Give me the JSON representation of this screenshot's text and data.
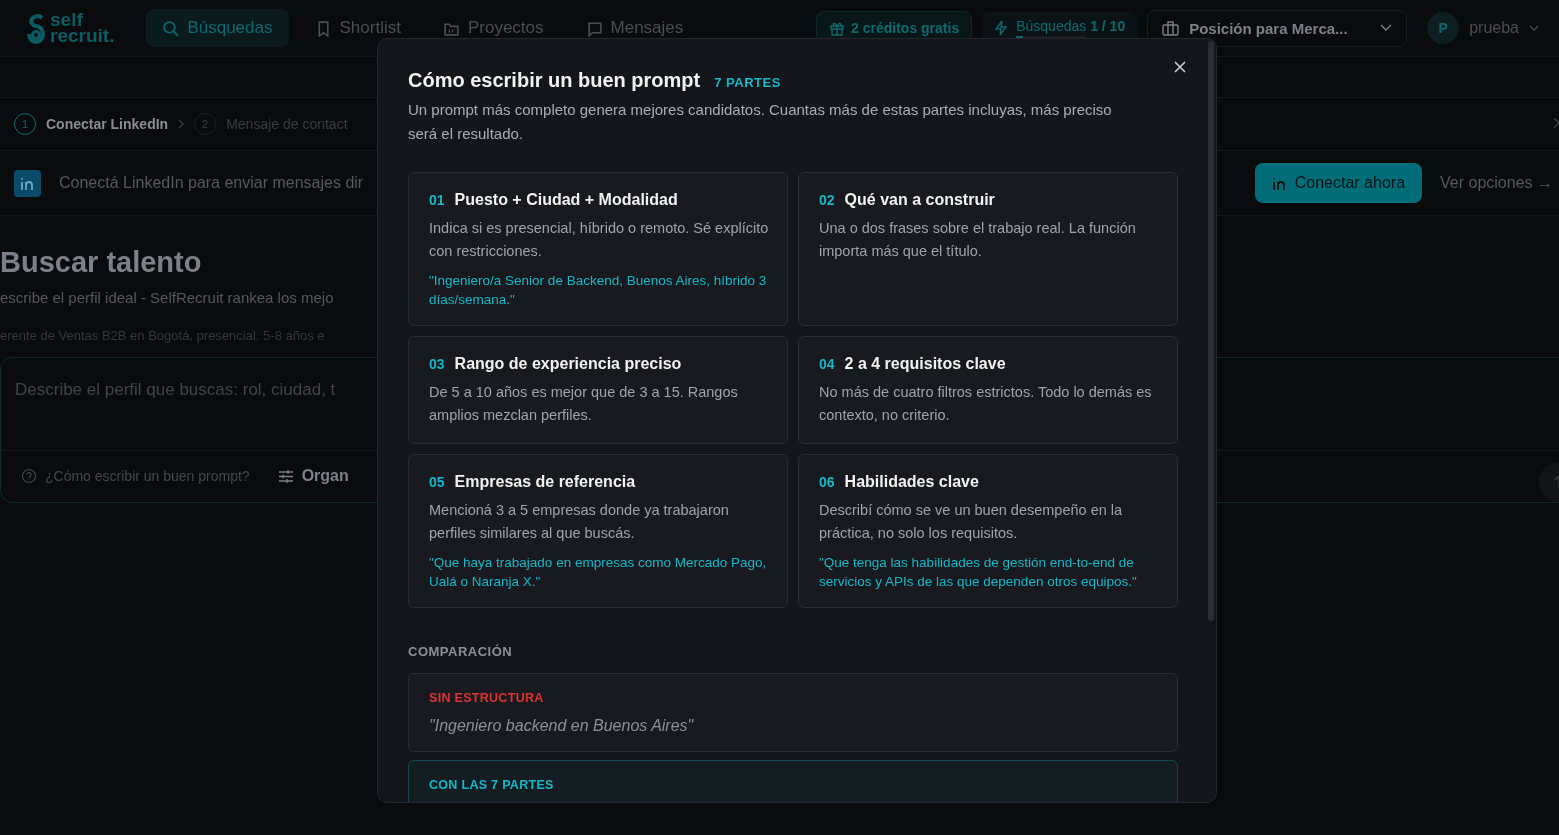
{
  "header": {
    "logo": [
      "self",
      "recruit."
    ],
    "nav": [
      {
        "label": "Búsquedas",
        "selected": true
      },
      {
        "label": "Shortlist",
        "selected": false
      },
      {
        "label": "Proyectos",
        "selected": false
      },
      {
        "label": "Mensajes",
        "selected": false
      }
    ],
    "credits": "2 créditos gratis",
    "searches": {
      "label": "Búsquedas",
      "count": "1 / 10",
      "level": 0.1
    },
    "position": "Posición para Merca...",
    "user": {
      "initial": "P",
      "name": "prueba"
    }
  },
  "steps": [
    {
      "number": "1",
      "label": "Conectar LinkedIn",
      "selected": true
    },
    {
      "number": "2",
      "label": "Mensaje de contact",
      "selected": false
    }
  ],
  "banner": {
    "text": "Conectá LinkedIn para enviar mensajes dir",
    "button": "Conectar ahora",
    "link": "Ver opciones →"
  },
  "main": {
    "title": "Buscar talento",
    "subtitle": "escribe el perfil ideal - SelfRecruit rankea los mejo",
    "example": "erente de Ventas B2B en Bogotá, presencial. 5-8 años e",
    "placeholder": "Describe el perfil que buscas: rol, ciudad, t",
    "help": "¿Cómo escribir un buen prompt?",
    "organize": "Organ"
  },
  "modal": {
    "title": "Cómo escribir un buen prompt",
    "badge": "7 PARTES",
    "intro": "Un prompt más completo genera mejores candidatos. Cuantas más de estas partes incluyas, más preciso será el resultado.",
    "parts": [
      {
        "number": "01",
        "title": "Puesto + Ciudad + Modalidad",
        "text": "Indica si es presencial, híbrido o remoto. Sé explícito con restricciones.",
        "example": "\"Ingeniero/a Senior de Backend, Buenos Aires, híbrido 3 días/semana.\""
      },
      {
        "number": "02",
        "title": "Qué van a construir",
        "text": "Una o dos frases sobre el trabajo real. La función importa más que el título."
      },
      {
        "number": "03",
        "title": "Rango de experiencia preciso",
        "text": "De 5 a 10 años es mejor que de 3 a 15. Rangos amplios mezclan perfiles."
      },
      {
        "number": "04",
        "title": "2 a 4 requisitos clave",
        "text": "No más de cuatro filtros estrictos. Todo lo demás es contexto, no criterio."
      },
      {
        "number": "05",
        "title": "Empresas de referencia",
        "text": "Mencioná 3 a 5 empresas donde ya trabajaron perfiles similares al que buscás.",
        "example": "\"Que haya trabajado en empresas como Mercado Pago, Ualá o Naranja X.\""
      },
      {
        "number": "06",
        "title": "Habilidades clave",
        "text": "Describí cómo se ve un buen desempeño en la práctica, no solo los requisitos.",
        "example": "\"Que tenga las habilidades de gestión end-to-end de servicios y APIs de las que dependen otros equipos.\""
      }
    ],
    "comparison_title": "COMPARACIÓN",
    "comparison": [
      {
        "kind": "bad",
        "label": "SIN ESTRUCTURA",
        "text": "\"Ingeniero backend en Buenos Aires\""
      },
      {
        "kind": "good",
        "label": "CON LAS 7 PARTES"
      }
    ]
  }
}
